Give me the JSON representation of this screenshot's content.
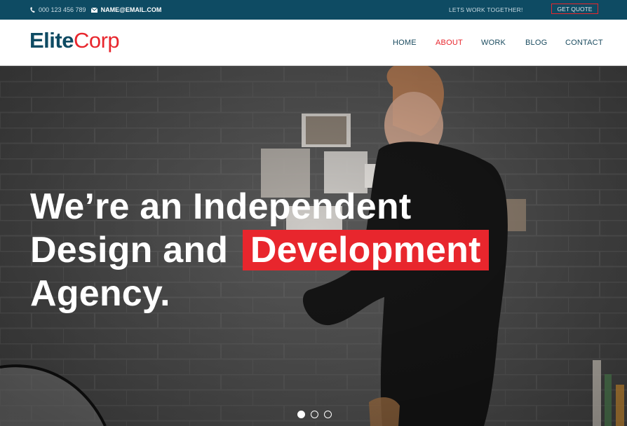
{
  "topbar": {
    "phone_icon": "phone-icon",
    "phone": "000 123 456 789",
    "email_icon": "envelope-icon",
    "email": "NAME@EMAIL.COM",
    "tagline": "LETS WORK TOGETHER!",
    "quote_label": "GET QUOTE"
  },
  "logo": {
    "part1": "Elite",
    "part2": "Corp"
  },
  "nav": {
    "items": [
      {
        "label": "HOME"
      },
      {
        "label": "ABOUT",
        "active": true
      },
      {
        "label": "WORK"
      },
      {
        "label": "BLOG"
      },
      {
        "label": "CONTACT"
      }
    ]
  },
  "hero": {
    "line1": "We’re an Independent",
    "line2_prefix": "Design and",
    "line2_highlight": "Development",
    "line3": "Agency.",
    "slider": {
      "count": 3,
      "active_index": 0
    }
  },
  "colors": {
    "topbar_bg": "#0e4b63",
    "accent": "#e8262d",
    "brand_dark": "#0e4b63",
    "nav_text": "#1a4b5f"
  }
}
